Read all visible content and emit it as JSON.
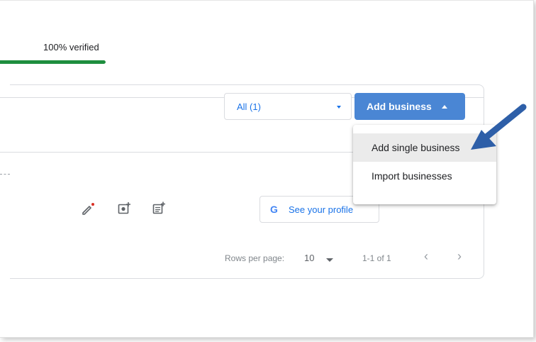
{
  "verification": {
    "label": "100% verified",
    "progress_percent": 100,
    "color": "#1e8e3e"
  },
  "filter": {
    "value": "All (1)",
    "icon": "dropdown-caret-icon"
  },
  "add_business": {
    "label": "Add business",
    "icon": "caret-up-icon",
    "color": "#4a86d4",
    "menu": [
      {
        "label": "Add single business",
        "highlighted": true
      },
      {
        "label": "Import businesses",
        "highlighted": false
      }
    ]
  },
  "row_actions": {
    "icons": [
      "edit-pencil-icon",
      "add-photo-icon",
      "add-post-icon"
    ],
    "profile_button": {
      "icon_letter": "G",
      "label": "See your profile"
    }
  },
  "pagination": {
    "rows_per_page_label": "Rows per page:",
    "rows_per_page": "10",
    "range": "1-1 of 1",
    "prev": "‹",
    "next": "›"
  },
  "annotation": {
    "icon": "pointer-arrow-icon",
    "color": "#2e5fa8"
  }
}
